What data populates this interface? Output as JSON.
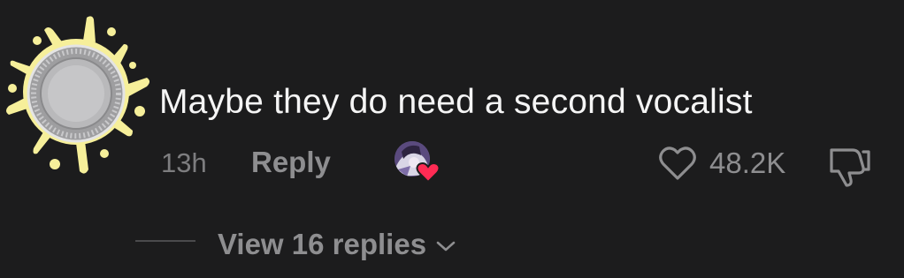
{
  "comment": {
    "text": "Maybe they do need a second vocalist",
    "time": "13h",
    "reply_label": "Reply",
    "like_count": "48.2K",
    "view_replies_label": "View 16 replies"
  },
  "icons": {
    "avatar": "coin-splash-avatar",
    "creator_like": "creator-liked-avatar-heart",
    "like": "heart-icon",
    "dislike": "thumbs-down-icon",
    "expand": "chevron-down-icon"
  },
  "colors": {
    "background": "#1c1c1d",
    "text_primary": "#f5f5f5",
    "text_secondary": "#8e8e90",
    "creator_heart": "#ff2b54",
    "splash_yellow": "#f6ef9a"
  }
}
